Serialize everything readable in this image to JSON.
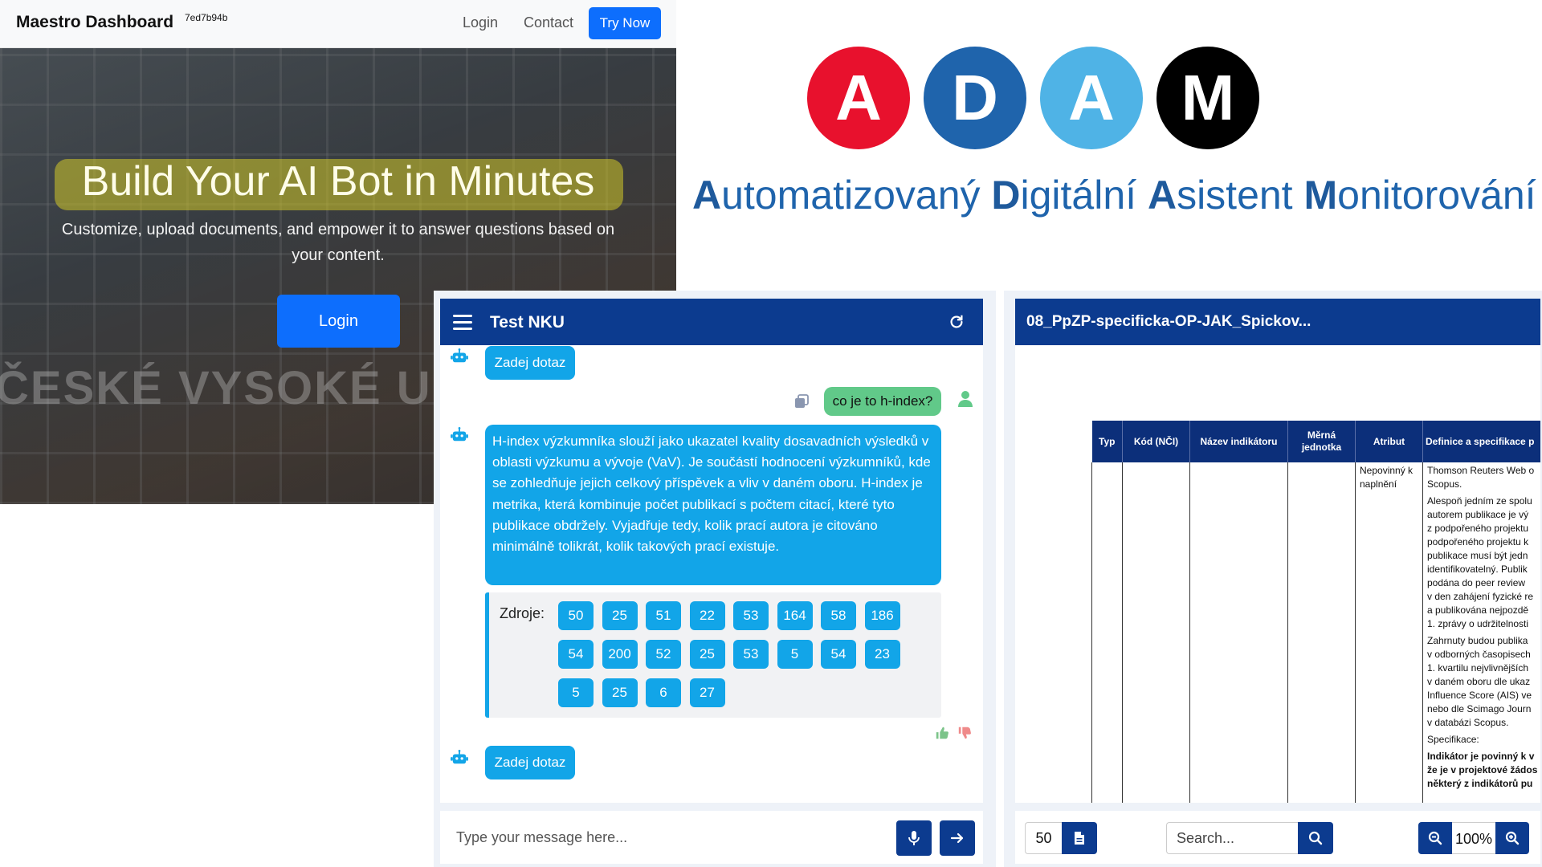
{
  "maestro": {
    "brand": "Maestro Dashboard",
    "build_hash": "7ed7b94b",
    "nav": {
      "login": "Login",
      "contact": "Contact",
      "try_now": "Try Now"
    },
    "hero": {
      "heading": "Build Your AI Bot in Minutes",
      "subtext": "Customize, upload documents, and empower it to answer questions based on your content.",
      "login_button": "Login",
      "background_text": "ČESKÉ VYSOKÉ UČENÍ TECHNICKÉ"
    }
  },
  "adam": {
    "letters": [
      "A",
      "D",
      "A",
      "M"
    ],
    "colors": [
      "#e8112d",
      "#1f64ac",
      "#4fb3e6",
      "#000000"
    ],
    "tagline_words": [
      {
        "initial": "A",
        "rest": "utomatizovaný"
      },
      {
        "initial": "D",
        "rest": "igitální"
      },
      {
        "initial": "A",
        "rest": "sistent"
      },
      {
        "initial": "M",
        "rest": "onitorování"
      }
    ]
  },
  "chat": {
    "title": "Test NKU",
    "prompt_bubble_top": "Zadej dotaz",
    "user_message": "co je to h-index?",
    "bot_answer": "H-index výzkumníka slouží jako ukazatel kvality dosavadních výsledků v oblasti výzkumu a vývoje (VaV). Je součástí hodnocení výzkumníků, kde se zohledňuje jejich celkový příspěvek a vliv v daném oboru. H-index je metrika, která kombinuje počet publikací s počtem citací, které tyto publikace obdržely. Vyjadřuje tedy, kolik prací autora je citováno minimálně tolikrát, kolik takových prací existuje.",
    "sources_label": "Zdroje:",
    "sources": [
      "50",
      "25",
      "51",
      "22",
      "53",
      "164",
      "58",
      "186",
      "54",
      "200",
      "52",
      "25",
      "53",
      "5",
      "54",
      "23",
      "5",
      "25",
      "6",
      "27"
    ],
    "prompt_bubble_bottom": "Zadej dotaz",
    "input_placeholder": "Type your message here...",
    "accent": "#12a5e8",
    "header_color": "#0c3b8f"
  },
  "document": {
    "title": "08_PpZP-specificka-OP-JAK_Spickov...",
    "table_headers": [
      "Typ",
      "Kód (NČI)",
      "Název indikátoru",
      "Měrná jednotka",
      "Atribut",
      "Definice a specifikace p"
    ],
    "atribut_value": "Nepovinný k naplnění",
    "definition_lines": [
      [
        "Thomson Reuters Web o",
        "Scopus."
      ],
      [
        "Alespoň jedním ze spolu",
        "autorem publikace je vý",
        "z podpořeného projektu",
        "podpořeného projektu k",
        "publikace musí být jedn",
        "identifikovatelný. Publik",
        "podána do peer review",
        "v den zahájení fyzické re",
        "a publikována nejpozdě",
        "1. zprávy o udržitelnosti"
      ],
      [
        "Zahrnuty budou publika",
        "v odborných časopisech",
        "1. kvartilu nejvlivnějších",
        "v daném oboru dle ukaz",
        "Influence Score (AIS) ve",
        "nebo dle Scimago Journ",
        "v databázi Scopus."
      ],
      [
        "Specifikace:"
      ],
      [
        "Indikátor je povinný k v",
        "že je v projektové žádos",
        "některý z indikátorů pu"
      ]
    ],
    "page_number": "50",
    "search_placeholder": "Search...",
    "zoom": "100%"
  }
}
